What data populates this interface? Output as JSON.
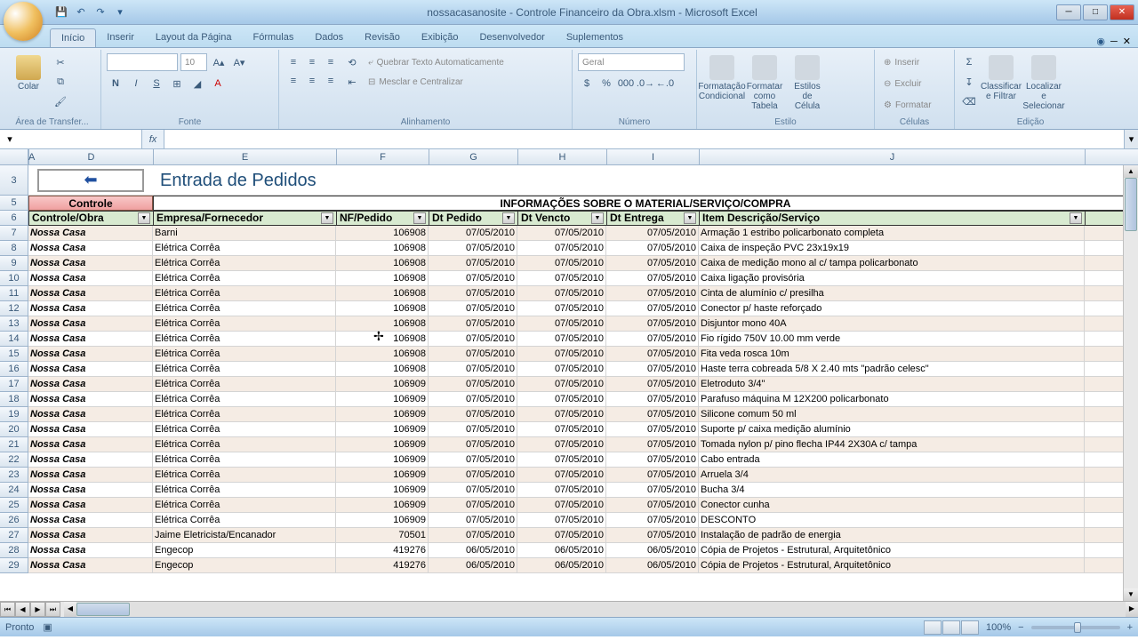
{
  "title": "nossacasanosite - Controle Financeiro da Obra.xlsm - Microsoft Excel",
  "ribbon_tabs": [
    "Início",
    "Inserir",
    "Layout da Página",
    "Fórmulas",
    "Dados",
    "Revisão",
    "Exibição",
    "Desenvolvedor",
    "Suplementos"
  ],
  "active_tab": 0,
  "ribbon_groups": {
    "clipboard": {
      "label": "Área de Transfer...",
      "paste": "Colar"
    },
    "font": {
      "label": "Fonte",
      "size": "10"
    },
    "alignment": {
      "label": "Alinhamento",
      "wrap": "Quebrar Texto Automaticamente",
      "merge": "Mesclar e Centralizar"
    },
    "number": {
      "label": "Número",
      "format": "Geral"
    },
    "styles": {
      "label": "Estilo",
      "conditional": "Formatação Condicional",
      "table": "Formatar como Tabela",
      "cell": "Estilos de Célula"
    },
    "cells": {
      "label": "Células",
      "insert": "Inserir",
      "delete": "Excluir",
      "format": "Formatar"
    },
    "editing": {
      "label": "Edição",
      "sort": "Classificar e Filtrar",
      "find": "Localizar e Selecionar"
    }
  },
  "name_box": "",
  "formula_bar": "",
  "sheet": {
    "title": "Entrada de Pedidos",
    "section1": "Controle",
    "section2": "INFORMAÇÕES SOBRE O MATERIAL/SERVIÇO/COMPRA",
    "columns": [
      "A",
      "D",
      "E",
      "F",
      "G",
      "H",
      "I",
      "J"
    ],
    "headers": [
      "Controle/Obra",
      "Empresa/Fornecedor",
      "NF/Pedido",
      "Dt Pedido",
      "Dt Vencto",
      "Dt Entrega",
      "Item Descrição/Serviço"
    ],
    "row_numbers": [
      3,
      5,
      6,
      7,
      8,
      9,
      10,
      11,
      12,
      13,
      14,
      15,
      16,
      17,
      18,
      19,
      20,
      21,
      22,
      23,
      24,
      25,
      26,
      27,
      28,
      29
    ],
    "rows": [
      {
        "obra": "Nossa Casa",
        "emp": "Barni",
        "nf": "106908",
        "ped": "07/05/2010",
        "venc": "07/05/2010",
        "ent": "07/05/2010",
        "desc": "Armação 1 estribo policarbonato completa"
      },
      {
        "obra": "Nossa Casa",
        "emp": "Elétrica Corrêa",
        "nf": "106908",
        "ped": "07/05/2010",
        "venc": "07/05/2010",
        "ent": "07/05/2010",
        "desc": "Caixa de inspeção PVC 23x19x19"
      },
      {
        "obra": "Nossa Casa",
        "emp": "Elétrica Corrêa",
        "nf": "106908",
        "ped": "07/05/2010",
        "venc": "07/05/2010",
        "ent": "07/05/2010",
        "desc": "Caixa de medição mono al c/ tampa policarbonato"
      },
      {
        "obra": "Nossa Casa",
        "emp": "Elétrica Corrêa",
        "nf": "106908",
        "ped": "07/05/2010",
        "venc": "07/05/2010",
        "ent": "07/05/2010",
        "desc": "Caixa ligação provisória"
      },
      {
        "obra": "Nossa Casa",
        "emp": "Elétrica Corrêa",
        "nf": "106908",
        "ped": "07/05/2010",
        "venc": "07/05/2010",
        "ent": "07/05/2010",
        "desc": "Cinta de alumínio c/ presilha"
      },
      {
        "obra": "Nossa Casa",
        "emp": "Elétrica Corrêa",
        "nf": "106908",
        "ped": "07/05/2010",
        "venc": "07/05/2010",
        "ent": "07/05/2010",
        "desc": "Conector p/ haste reforçado"
      },
      {
        "obra": "Nossa Casa",
        "emp": "Elétrica Corrêa",
        "nf": "106908",
        "ped": "07/05/2010",
        "venc": "07/05/2010",
        "ent": "07/05/2010",
        "desc": "Disjuntor mono 40A"
      },
      {
        "obra": "Nossa Casa",
        "emp": "Elétrica Corrêa",
        "nf": "106908",
        "ped": "07/05/2010",
        "venc": "07/05/2010",
        "ent": "07/05/2010",
        "desc": "Fio rígido 750V 10.00 mm verde"
      },
      {
        "obra": "Nossa Casa",
        "emp": "Elétrica Corrêa",
        "nf": "106908",
        "ped": "07/05/2010",
        "venc": "07/05/2010",
        "ent": "07/05/2010",
        "desc": "Fita veda rosca 10m"
      },
      {
        "obra": "Nossa Casa",
        "emp": "Elétrica Corrêa",
        "nf": "106908",
        "ped": "07/05/2010",
        "venc": "07/05/2010",
        "ent": "07/05/2010",
        "desc": "Haste terra cobreada 5/8 X 2.40 mts \"padrão celesc\""
      },
      {
        "obra": "Nossa Casa",
        "emp": "Elétrica Corrêa",
        "nf": "106909",
        "ped": "07/05/2010",
        "venc": "07/05/2010",
        "ent": "07/05/2010",
        "desc": "Eletroduto 3/4\""
      },
      {
        "obra": "Nossa Casa",
        "emp": "Elétrica Corrêa",
        "nf": "106909",
        "ped": "07/05/2010",
        "venc": "07/05/2010",
        "ent": "07/05/2010",
        "desc": "Parafuso máquina M 12X200 policarbonato"
      },
      {
        "obra": "Nossa Casa",
        "emp": "Elétrica Corrêa",
        "nf": "106909",
        "ped": "07/05/2010",
        "venc": "07/05/2010",
        "ent": "07/05/2010",
        "desc": "Silicone comum 50 ml"
      },
      {
        "obra": "Nossa Casa",
        "emp": "Elétrica Corrêa",
        "nf": "106909",
        "ped": "07/05/2010",
        "venc": "07/05/2010",
        "ent": "07/05/2010",
        "desc": "Suporte p/ caixa medição alumínio"
      },
      {
        "obra": "Nossa Casa",
        "emp": "Elétrica Corrêa",
        "nf": "106909",
        "ped": "07/05/2010",
        "venc": "07/05/2010",
        "ent": "07/05/2010",
        "desc": "Tomada nylon p/ pino flecha IP44 2X30A c/ tampa"
      },
      {
        "obra": "Nossa Casa",
        "emp": "Elétrica Corrêa",
        "nf": "106909",
        "ped": "07/05/2010",
        "venc": "07/05/2010",
        "ent": "07/05/2010",
        "desc": "Cabo entrada"
      },
      {
        "obra": "Nossa Casa",
        "emp": "Elétrica Corrêa",
        "nf": "106909",
        "ped": "07/05/2010",
        "venc": "07/05/2010",
        "ent": "07/05/2010",
        "desc": "Arruela 3/4"
      },
      {
        "obra": "Nossa Casa",
        "emp": "Elétrica Corrêa",
        "nf": "106909",
        "ped": "07/05/2010",
        "venc": "07/05/2010",
        "ent": "07/05/2010",
        "desc": "Bucha 3/4"
      },
      {
        "obra": "Nossa Casa",
        "emp": "Elétrica Corrêa",
        "nf": "106909",
        "ped": "07/05/2010",
        "venc": "07/05/2010",
        "ent": "07/05/2010",
        "desc": "Conector cunha"
      },
      {
        "obra": "Nossa Casa",
        "emp": "Elétrica Corrêa",
        "nf": "106909",
        "ped": "07/05/2010",
        "venc": "07/05/2010",
        "ent": "07/05/2010",
        "desc": "DESCONTO"
      },
      {
        "obra": "Nossa Casa",
        "emp": "Jaime Eletricista/Encanador",
        "nf": "70501",
        "ped": "07/05/2010",
        "venc": "07/05/2010",
        "ent": "07/05/2010",
        "desc": "Instalação de padrão de energia"
      },
      {
        "obra": "Nossa Casa",
        "emp": "Engecop",
        "nf": "419276",
        "ped": "06/05/2010",
        "venc": "06/05/2010",
        "ent": "06/05/2010",
        "desc": "Cópia de Projetos - Estrutural, Arquitetônico"
      },
      {
        "obra": "Nossa Casa",
        "emp": "Engecop",
        "nf": "419276",
        "ped": "06/05/2010",
        "venc": "06/05/2010",
        "ent": "06/05/2010",
        "desc": "Cópia de Projetos - Estrutural, Arquitetônico"
      }
    ]
  },
  "statusbar": {
    "ready": "Pronto",
    "zoom": "100%"
  }
}
